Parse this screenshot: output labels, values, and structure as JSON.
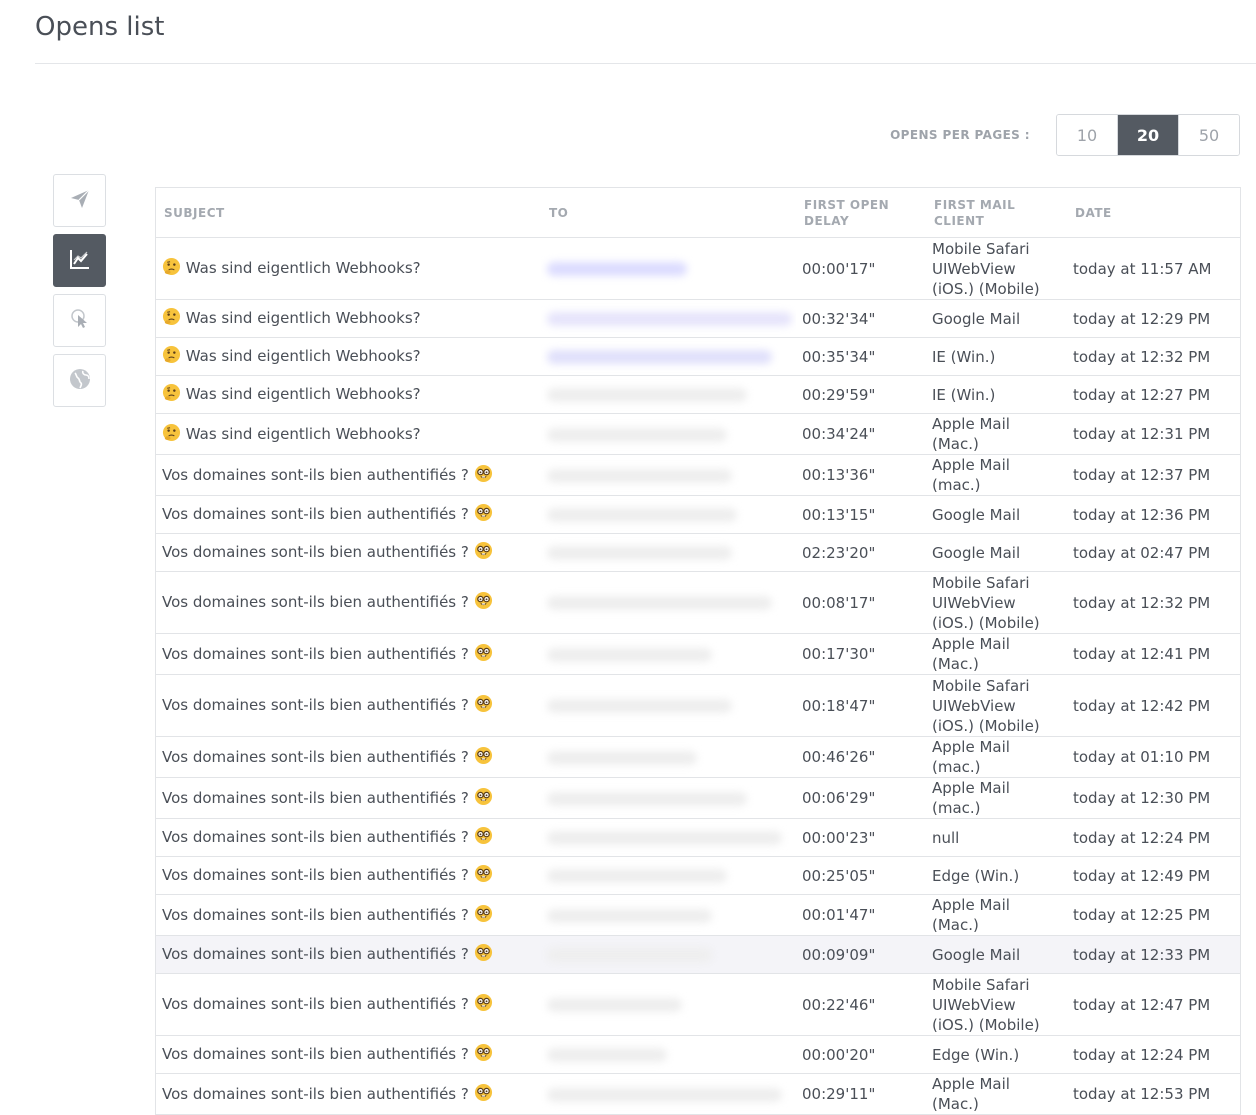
{
  "page": {
    "title": "Opens list"
  },
  "per_page": {
    "label": "OPENS PER PAGES :",
    "options": [
      "10",
      "20",
      "50"
    ],
    "selected": "20"
  },
  "side_nav": {
    "items": [
      {
        "icon": "paper-plane-icon",
        "active": false
      },
      {
        "icon": "line-chart-icon",
        "active": true
      },
      {
        "icon": "click-pointer-icon",
        "active": false
      },
      {
        "icon": "globe-icon",
        "active": false
      }
    ]
  },
  "colors": {
    "accent_dark": "#545a62",
    "border": "#e2e4e7",
    "header_text": "#a4a9b0",
    "highlight_row": "#f4f4f8"
  },
  "table": {
    "headers": {
      "subject": "SUBJECT",
      "to": "TO",
      "delay": "FIRST OPEN DELAY",
      "client": "FIRST MAIL CLIENT",
      "date": "DATE"
    },
    "rows": [
      {
        "emoji": "thinking-face",
        "subject": "Was sind eigentlich Webhooks?",
        "delay": "00:00'17\"",
        "client": "Mobile Safari UIWebView (iOS.) (Mobile)",
        "date": "today at 11:57 AM"
      },
      {
        "emoji": "thinking-face",
        "subject": "Was sind eigentlich Webhooks?",
        "delay": "00:32'34\"",
        "client": "Google Mail",
        "date": "today at 12:29 PM"
      },
      {
        "emoji": "thinking-face",
        "subject": "Was sind eigentlich Webhooks?",
        "delay": "00:35'34\"",
        "client": "IE (Win.)",
        "date": "today at 12:32 PM"
      },
      {
        "emoji": "thinking-face",
        "subject": "Was sind eigentlich Webhooks?",
        "delay": "00:29'59\"",
        "client": "IE (Win.)",
        "date": "today at 12:27 PM"
      },
      {
        "emoji": "thinking-face",
        "subject": "Was sind eigentlich Webhooks?",
        "delay": "00:34'24\"",
        "client": "Apple Mail (Mac.)",
        "date": "today at 12:31 PM"
      },
      {
        "emoji": "nerd-face",
        "subject": "Vos domaines sont-ils bien authentifiés ?",
        "delay": "00:13'36\"",
        "client": "Apple Mail (mac.)",
        "date": "today at 12:37 PM"
      },
      {
        "emoji": "nerd-face",
        "subject": "Vos domaines sont-ils bien authentifiés ?",
        "delay": "00:13'15\"",
        "client": "Google Mail",
        "date": "today at 12:36 PM"
      },
      {
        "emoji": "nerd-face",
        "subject": "Vos domaines sont-ils bien authentifiés ?",
        "delay": "02:23'20\"",
        "client": "Google Mail",
        "date": "today at 02:47 PM"
      },
      {
        "emoji": "nerd-face",
        "subject": "Vos domaines sont-ils bien authentifiés ?",
        "delay": "00:08'17\"",
        "client": "Mobile Safari UIWebView (iOS.) (Mobile)",
        "date": "today at 12:32 PM"
      },
      {
        "emoji": "nerd-face",
        "subject": "Vos domaines sont-ils bien authentifiés ?",
        "delay": "00:17'30\"",
        "client": "Apple Mail (Mac.)",
        "date": "today at 12:41 PM"
      },
      {
        "emoji": "nerd-face",
        "subject": "Vos domaines sont-ils bien authentifiés ?",
        "delay": "00:18'47\"",
        "client": "Mobile Safari UIWebView (iOS.) (Mobile)",
        "date": "today at 12:42 PM"
      },
      {
        "emoji": "nerd-face",
        "subject": "Vos domaines sont-ils bien authentifiés ?",
        "delay": "00:46'26\"",
        "client": "Apple Mail (mac.)",
        "date": "today at 01:10 PM"
      },
      {
        "emoji": "nerd-face",
        "subject": "Vos domaines sont-ils bien authentifiés ?",
        "delay": "00:06'29\"",
        "client": "Apple Mail (mac.)",
        "date": "today at 12:30 PM"
      },
      {
        "emoji": "nerd-face",
        "subject": "Vos domaines sont-ils bien authentifiés ?",
        "delay": "00:00'23\"",
        "client": "null",
        "date": "today at 12:24 PM"
      },
      {
        "emoji": "nerd-face",
        "subject": "Vos domaines sont-ils bien authentifiés ?",
        "delay": "00:25'05\"",
        "client": "Edge (Win.)",
        "date": "today at 12:49 PM"
      },
      {
        "emoji": "nerd-face",
        "subject": "Vos domaines sont-ils bien authentifiés ?",
        "delay": "00:01'47\"",
        "client": "Apple Mail (Mac.)",
        "date": "today at 12:25 PM"
      },
      {
        "emoji": "nerd-face",
        "subject": "Vos domaines sont-ils bien authentifiés ?",
        "delay": "00:09'09\"",
        "client": "Google Mail",
        "date": "today at 12:33 PM",
        "highlighted": true
      },
      {
        "emoji": "nerd-face",
        "subject": "Vos domaines sont-ils bien authentifiés ?",
        "delay": "00:22'46\"",
        "client": "Mobile Safari UIWebView (iOS.) (Mobile)",
        "date": "today at 12:47 PM"
      },
      {
        "emoji": "nerd-face",
        "subject": "Vos domaines sont-ils bien authentifiés ?",
        "delay": "00:00'20\"",
        "client": "Edge (Win.)",
        "date": "today at 12:24 PM"
      },
      {
        "emoji": "nerd-face",
        "subject": "Vos domaines sont-ils bien authentifiés ?",
        "delay": "00:29'11\"",
        "client": "Apple Mail (Mac.)",
        "date": "today at 12:53 PM"
      }
    ]
  }
}
